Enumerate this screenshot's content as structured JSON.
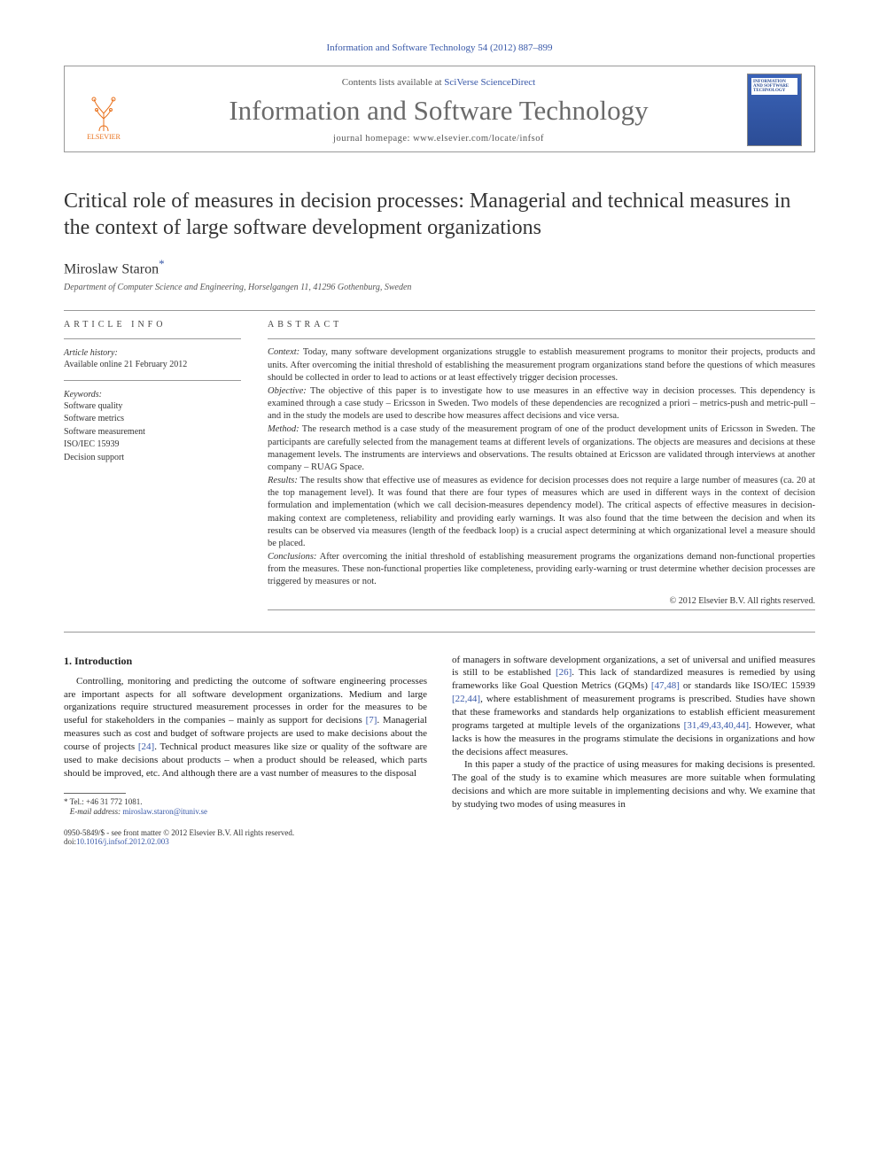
{
  "citation": "Information and Software Technology 54 (2012) 887–899",
  "masthead": {
    "contents_prefix": "Contents lists available at ",
    "contents_link": "SciVerse ScienceDirect",
    "journal": "Information and Software Technology",
    "homepage_prefix": "journal homepage: ",
    "homepage_url": "www.elsevier.com/locate/infsof",
    "publisher": "ELSEVIER",
    "cover_text": "INFORMATION AND SOFTWARE TECHNOLOGY"
  },
  "title": "Critical role of measures in decision processes: Managerial and technical measures in the context of large software development organizations",
  "author": "Miroslaw Staron",
  "corr_mark": "*",
  "affiliation": "Department of Computer Science and Engineering, Horselgangen 11, 41296 Gothenburg, Sweden",
  "info": {
    "heading": "ARTICLE INFO",
    "history_title": "Article history:",
    "history_text": "Available online 21 February 2012",
    "keywords_title": "Keywords:",
    "keywords": [
      "Software quality",
      "Software metrics",
      "Software measurement",
      "ISO/IEC 15939",
      "Decision support"
    ]
  },
  "abstract": {
    "heading": "ABSTRACT",
    "paras": [
      {
        "lead": "Context:",
        "text": " Today, many software development organizations struggle to establish measurement programs to monitor their projects, products and units. After overcoming the initial threshold of establishing the measurement program organizations stand before the questions of which measures should be collected in order to lead to actions or at least effectively trigger decision processes."
      },
      {
        "lead": "Objective:",
        "text": " The objective of this paper is to investigate how to use measures in an effective way in decision processes. This dependency is examined through a case study – Ericsson in Sweden. Two models of these dependencies are recognized a priori – metrics-push and metric-pull – and in the study the models are used to describe how measures affect decisions and vice versa."
      },
      {
        "lead": "Method:",
        "text": " The research method is a case study of the measurement program of one of the product development units of Ericsson in Sweden. The participants are carefully selected from the management teams at different levels of organizations. The objects are measures and decisions at these management levels. The instruments are interviews and observations. The results obtained at Ericsson are validated through interviews at another company – RUAG Space."
      },
      {
        "lead": "Results:",
        "text": " The results show that effective use of measures as evidence for decision processes does not require a large number of measures (ca. 20 at the top management level). It was found that there are four types of measures which are used in different ways in the context of decision formulation and implementation (which we call decision-measures dependency model). The critical aspects of effective measures in decision-making context are completeness, reliability and providing early warnings. It was also found that the time between the decision and when its results can be observed via measures (length of the feedback loop) is a crucial aspect determining at which organizational level a measure should be placed."
      },
      {
        "lead": "Conclusions:",
        "text": " After overcoming the initial threshold of establishing measurement programs the organizations demand non-functional properties from the measures. These non-functional properties like completeness, providing early-warning or trust determine whether decision processes are triggered by measures or not."
      }
    ],
    "copyright": "© 2012 Elsevier B.V. All rights reserved."
  },
  "body": {
    "heading": "1. Introduction",
    "p1a": "Controlling, monitoring and predicting the outcome of software engineering processes are important aspects for all software development organizations. Medium and large organizations require structured measurement processes in order for the measures to be useful for stakeholders in the companies – mainly as support for decisions ",
    "p1_ref1": "[7]",
    "p1b": ". Managerial measures such as cost and budget of software projects are used to make decisions about the course of projects ",
    "p1_ref2": "[24]",
    "p1c": ". Technical product measures like size or quality of the software are used to make decisions about products – when a product should be released, which parts should be improved, etc. And although there are a vast number of measures to the disposal",
    "p2a": "of managers in software development organizations, a set of universal and unified measures is still to be established ",
    "p2_ref1": "[26]",
    "p2b": ". This lack of standardized measures is remedied by using frameworks like Goal Question Metrics (GQMs) ",
    "p2_ref2": "[47,48]",
    "p2c": " or standards like ISO/IEC 15939 ",
    "p2_ref3": "[22,44]",
    "p2d": ", where establishment of measurement programs is prescribed. Studies have shown that these frameworks and standards help organizations to establish efficient measurement programs targeted at multiple levels of the organizations ",
    "p2_ref4": "[31,49,43,40,44]",
    "p2e": ". However, what lacks is how the measures in the programs stimulate the decisions in organizations and how the decisions affect measures.",
    "p3": "In this paper a study of the practice of using measures for making decisions is presented. The goal of the study is to examine which measures are more suitable when formulating decisions and which are more suitable in implementing decisions and why. We examine that by studying two modes of using measures in"
  },
  "footnote": {
    "corr_mark": "*",
    "tel_label": "Tel.: ",
    "tel": "+46 31 772 1081.",
    "email_label": "E-mail address: ",
    "email": "miroslaw.staron@ituniv.se"
  },
  "footer": {
    "issn_line": "0950-5849/$ - see front matter © 2012 Elsevier B.V. All rights reserved.",
    "doi_label": "doi:",
    "doi": "10.1016/j.infsof.2012.02.003"
  }
}
